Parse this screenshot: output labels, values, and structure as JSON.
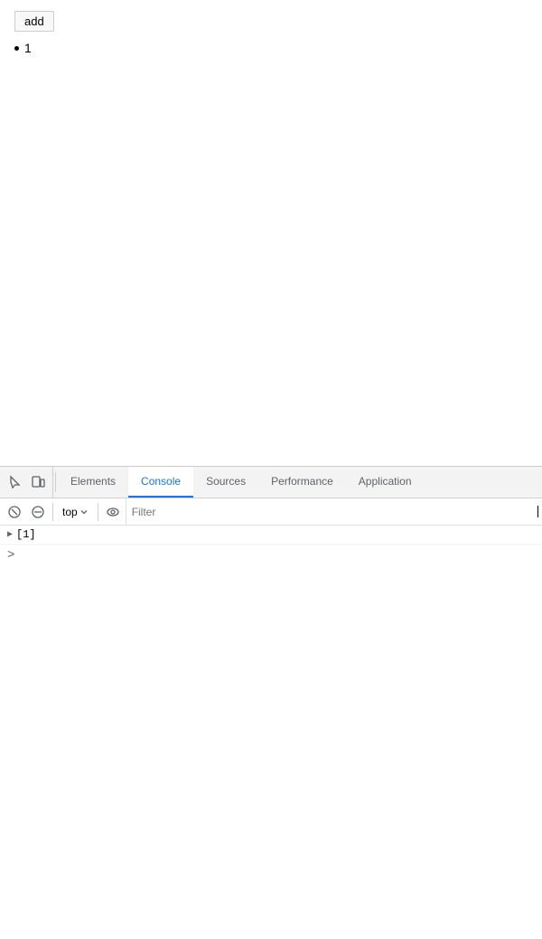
{
  "page": {
    "add_button_label": "add",
    "bullet_number": "1"
  },
  "devtools": {
    "tabs": [
      {
        "id": "elements",
        "label": "Elements",
        "active": false
      },
      {
        "id": "console",
        "label": "Console",
        "active": true
      },
      {
        "id": "sources",
        "label": "Sources",
        "active": false
      },
      {
        "id": "performance",
        "label": "Performance",
        "active": false
      },
      {
        "id": "application",
        "label": "Application",
        "active": false
      }
    ],
    "toolbar": {
      "context": "top",
      "filter_placeholder": "Filter"
    },
    "console": {
      "log_entry": "▶ [1]",
      "prompt_symbol": ">"
    }
  }
}
